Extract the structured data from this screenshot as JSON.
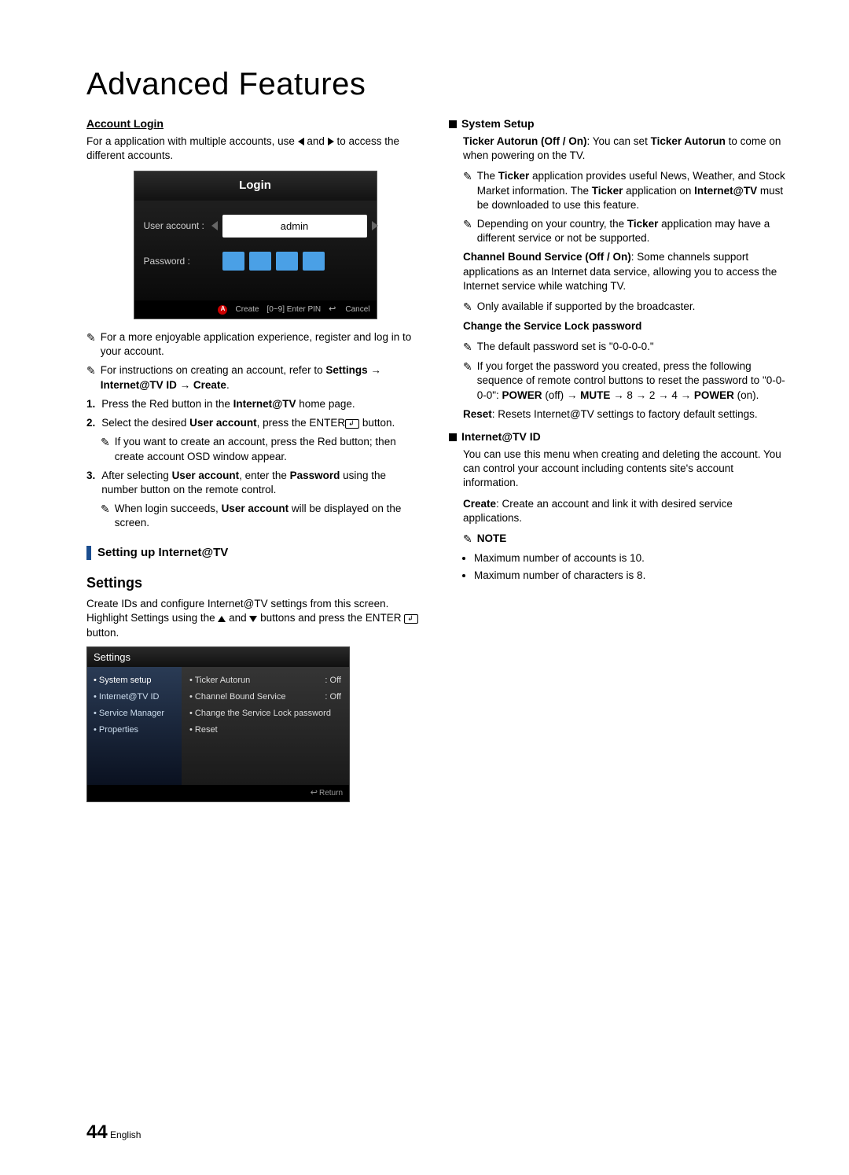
{
  "page": {
    "title": "Advanced Features",
    "number": "44",
    "lang": "English"
  },
  "left": {
    "account_login_head": "Account Login",
    "account_login_text_a": "For a application with multiple accounts, use ",
    "account_login_text_b": " and ",
    "account_login_text_c": " to access the different accounts.",
    "login_panel": {
      "title": "Login",
      "user_label": "User account :",
      "user_value": "admin",
      "pass_label": "Password :",
      "footer_create": "Create",
      "footer_pin": "[0~9] Enter PIN",
      "footer_cancel": "Cancel"
    },
    "note1": "For a more enjoyable application experience, register and log in to your account.",
    "note2_a": "For instructions on creating an account, refer to ",
    "note2_b": "Settings → Internet@TV ID → Create",
    "note2_c": ".",
    "steps": [
      {
        "n": "1.",
        "a": "Press the Red button in the ",
        "b": "Internet@TV",
        "c": " home page."
      },
      {
        "n": "2.",
        "a": "Select the desired ",
        "b": "User account",
        "c": ", press the ENTER",
        "d": " button."
      },
      {
        "n": "3.",
        "a_pre": "After selecting ",
        "a_b1": "User account",
        "a_mid": ", enter the ",
        "a_b2": "Password",
        "a_post": " using the number button on the remote control."
      }
    ],
    "step2_note": "If you want to create an account, press the Red button; then create account OSD window appear.",
    "step3_note_a": "When login succeeds, ",
    "step3_note_b": "User account",
    "step3_note_c": " will be displayed on the screen.",
    "section_bar": "Setting up Internet@TV",
    "settings_h3": "Settings",
    "settings_intro_a": "Create IDs and configure Internet@TV settings from this screen. Highlight Settings using the ",
    "settings_intro_b": " and ",
    "settings_intro_c": " buttons and press the ENTER",
    "settings_intro_d": " button.",
    "settings_panel": {
      "header": "Settings",
      "left_items": [
        "• System setup",
        "• Internet@TV ID",
        "• Service Manager",
        "• Properties"
      ],
      "right_items": [
        {
          "label": "• Ticker Autorun",
          "val": ": Off"
        },
        {
          "label": "• Channel Bound Service",
          "val": ": Off"
        },
        {
          "label": "• Change the Service Lock password",
          "val": ""
        },
        {
          "label": "• Reset",
          "val": ""
        }
      ],
      "footer": "Return"
    }
  },
  "right": {
    "sys_setup_head": "System Setup",
    "ticker_bold": "Ticker Autorun (Off / On)",
    "ticker_rest": ": You can set ",
    "ticker_bold2": "Ticker Autorun",
    "ticker_rest2": " to come on when powering on the TV.",
    "ticker_note1_a": "The ",
    "ticker_note1_b": "Ticker",
    "ticker_note1_c": " application provides useful News, Weather, and Stock Market information. The ",
    "ticker_note1_d": "Ticker",
    "ticker_note1_e": " application on ",
    "ticker_note1_f": "Internet@TV",
    "ticker_note1_g": " must be downloaded to use this feature.",
    "ticker_note2_a": "Depending on your country, the ",
    "ticker_note2_b": "Ticker",
    "ticker_note2_c": " application may have a different service or not be supported.",
    "cbs_bold": "Channel Bound Service (Off / On)",
    "cbs_rest": ": Some channels support applications as an Internet data service, allowing you to access the Internet service while watching TV.",
    "cbs_note": "Only available if supported by the broadcaster.",
    "change_pw_head": "Change the Service Lock password",
    "change_pw_note1": "The default password set is \"0-0-0-0.\"",
    "change_pw_note2_a": "If you forget the password you created, press the following sequence of remote control buttons to reset the password to \"0-0-0-0\": ",
    "change_pw_note2_b": "POWER",
    "change_pw_note2_c": " (off) → ",
    "change_pw_note2_d": "MUTE",
    "change_pw_note2_e": " → 8 → 2 → 4 → ",
    "change_pw_note2_f": "POWER",
    "change_pw_note2_g": " (on).",
    "reset_bold": "Reset",
    "reset_rest": ": Resets Internet@TV settings to factory default settings.",
    "itv_head": "Internet@TV ID",
    "itv_p1": "You can use this menu when creating and deleting the account. You can control your account including contents site's account information.",
    "itv_create_b": "Create",
    "itv_create_rest": ": Create an account and link it with desired service applications.",
    "note_label": "NOTE",
    "bullets": [
      "Maximum number of accounts is 10.",
      "Maximum number of characters is 8."
    ]
  }
}
